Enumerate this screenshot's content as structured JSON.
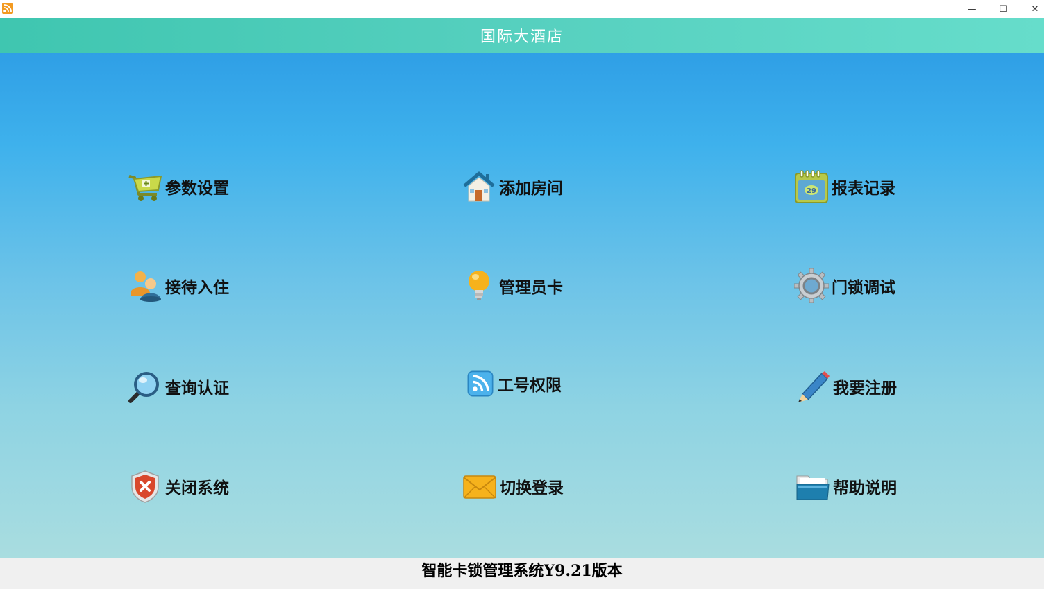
{
  "window": {
    "minimize_glyph": "—",
    "maximize_glyph": "☐",
    "close_glyph": "✕"
  },
  "header": {
    "title": "国际大酒店"
  },
  "menu": {
    "items": [
      {
        "label": "参数设置",
        "icon": "shopping-cart-icon"
      },
      {
        "label": "添加房间",
        "icon": "house-icon"
      },
      {
        "label": "报表记录",
        "icon": "calendar-icon"
      },
      {
        "label": "接待入住",
        "icon": "users-icon"
      },
      {
        "label": "管理员卡",
        "icon": "lightbulb-icon"
      },
      {
        "label": "门锁调试",
        "icon": "gear-icon"
      },
      {
        "label": "查询认证",
        "icon": "magnifier-icon"
      },
      {
        "label": "工号权限",
        "icon": "rss-icon"
      },
      {
        "label": "我要注册",
        "icon": "pencil-icon"
      },
      {
        "label": "关闭系统",
        "icon": "shield-close-icon"
      },
      {
        "label": "切换登录",
        "icon": "envelope-icon"
      },
      {
        "label": "帮助说明",
        "icon": "folder-icon"
      }
    ]
  },
  "footer": {
    "text": "智能卡锁管理系统Y9.21版本"
  },
  "colors": {
    "header_start": "#3fc6b0",
    "header_end": "#66ddcb",
    "main_top": "#2f9fe6",
    "main_bottom": "#a9dde0"
  }
}
